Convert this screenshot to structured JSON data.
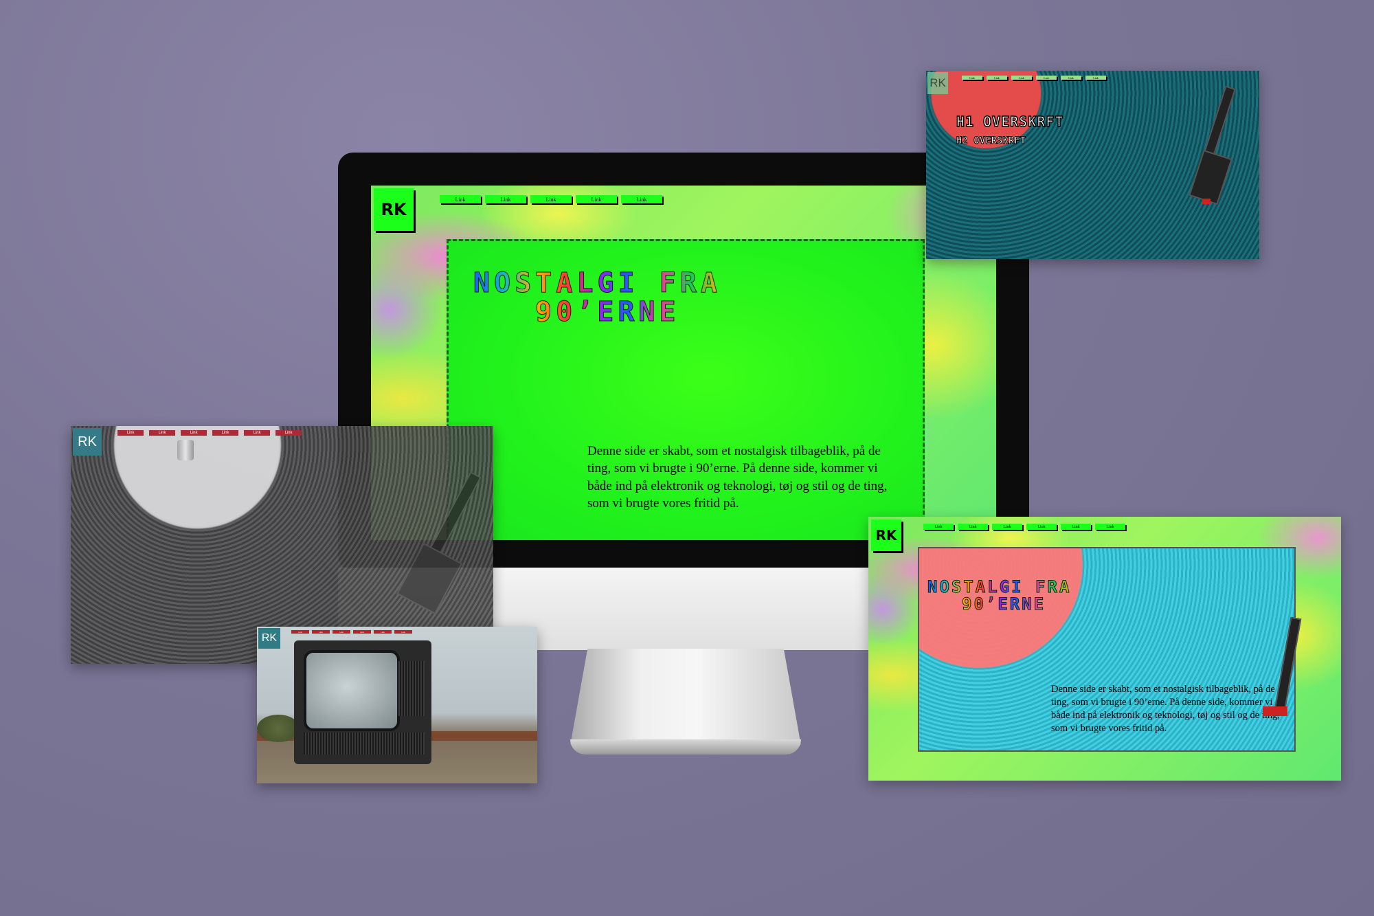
{
  "monitor": {
    "logo": "RK",
    "nav": [
      "Link",
      "Link",
      "Link",
      "Link",
      "Link"
    ],
    "title_line1": "NOSTALGI FRA",
    "title_line2": "90’ERNE",
    "body_text": "Denne side er skabt, som et nostalgisk tilbageblik, på de ting, som vi brugte i 90’erne. På denne side, kommer vi både ind på elektronik og teknologi, tøj og stil og de ting, som vi brugte vores fritid på."
  },
  "card_top_right": {
    "logo": "RK",
    "nav": [
      "Link",
      "Link",
      "Link",
      "Link",
      "Link",
      "Link"
    ],
    "h1": "H1 OVERSKRFT",
    "h2": "H2 OVERSKRFT"
  },
  "card_left_vinyl": {
    "logo": "RK",
    "nav": [
      "Link",
      "Link",
      "Link",
      "Link",
      "Link",
      "Link"
    ]
  },
  "card_tv": {
    "logo": "RK",
    "nav": [
      "Link",
      "Link",
      "Link",
      "Link",
      "Link",
      "Link"
    ]
  },
  "card_bottom_right": {
    "logo": "RK",
    "nav": [
      "Link",
      "Link",
      "Link",
      "Link",
      "Link",
      "Link"
    ],
    "title_line1": "NOSTALGI FRA",
    "title_line2": "90’ERNE",
    "body_text": "Denne side er skabt, som et nostalgisk tilbageblik, på de ting, som vi brugte i 90’erne. På denne side, kommer vi både ind på elektronik og teknologi, tøj og stil og de ting, som vi brugte vores fritid på."
  },
  "colors": {
    "background": "#7b7596",
    "neon_green": "#1bff1b",
    "link_red": "#b3222e",
    "teal_logo": "#2f7b86"
  }
}
